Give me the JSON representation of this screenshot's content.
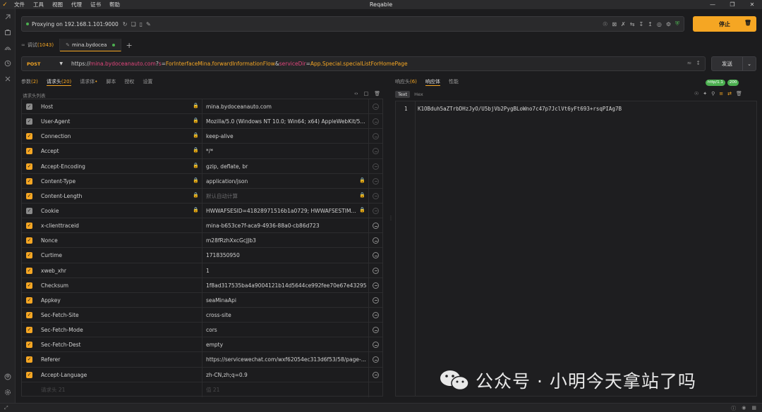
{
  "window": {
    "title": "Reqable",
    "menu": [
      "文件",
      "工具",
      "视图",
      "代理",
      "证书",
      "帮助"
    ]
  },
  "proxy": {
    "status_text": "Proxying on 192.168.1.101:9000",
    "stop_label": "停止"
  },
  "tabs": [
    {
      "label": "调试",
      "count": "(1043)"
    },
    {
      "label": "mina.bydocea"
    }
  ],
  "request": {
    "method": "POST",
    "url_scheme": "https://",
    "url_host": "mina.bydoceanauto.com",
    "url_q": "?",
    "param1_name": "s",
    "param1_eq": "=",
    "param1_value": "ForInterfaceMina.forwardInformationFlow",
    "param_amp": "&",
    "param2_name": "serviceDir",
    "param2_eq": "=",
    "param2_value": "App.Special.specialListForHomePage",
    "send_label": "发送"
  },
  "subtabs": [
    {
      "label": "参数",
      "count": "(2)"
    },
    {
      "label": "请求头",
      "count": "(20)"
    },
    {
      "label": "请求体",
      "count": "•"
    },
    {
      "label": "脚本",
      "count": ""
    },
    {
      "label": "授权",
      "count": ""
    },
    {
      "label": "设置",
      "count": ""
    }
  ],
  "headers_list_label": "请求头列表",
  "headers": [
    {
      "key": "Host",
      "value": "mina.bydoceanauto.com"
    },
    {
      "key": "User-Agent",
      "value": "Mozilla/5.0 (Windows NT 10.0; Win64; x64) AppleWebKit/5..."
    },
    {
      "key": "Connection",
      "value": "keep-alive"
    },
    {
      "key": "Accept",
      "value": "*/*"
    },
    {
      "key": "Accept-Encoding",
      "value": "gzip, deflate, br"
    },
    {
      "key": "Content-Type",
      "value": "application/json"
    },
    {
      "key": "Content-Length",
      "value": "默认自动计算"
    },
    {
      "key": "Cookie",
      "value": "HWWAFSESID=41828971516b1a0729; HWWAFSESTIM..."
    },
    {
      "key": "x-clienttraceid",
      "value": "mina-b653ce7f-aca9-4936-88a0-cb86d723"
    },
    {
      "key": "Nonce",
      "value": "m28fRzhXxcGcJJb3"
    },
    {
      "key": "Curtime",
      "value": "1718350950"
    },
    {
      "key": "xweb_xhr",
      "value": "1"
    },
    {
      "key": "Checksum",
      "value": "1f8ad317535ba4a9004121b14d5644ce992fee70e67e43295..."
    },
    {
      "key": "Appkey",
      "value": "seaMinaApi"
    },
    {
      "key": "Sec-Fetch-Site",
      "value": "cross-site"
    },
    {
      "key": "Sec-Fetch-Mode",
      "value": "cors"
    },
    {
      "key": "Sec-Fetch-Dest",
      "value": "empty"
    },
    {
      "key": "Referer",
      "value": "https://servicewechat.com/wxf62054ec313d6f53/58/page-..."
    },
    {
      "key": "Accept-Language",
      "value": "zh-CN,zh;q=0.9"
    },
    {
      "key": "请求头 21",
      "value": "值 21"
    }
  ],
  "response": {
    "tabs": [
      {
        "label": "响应头",
        "count": "(6)"
      },
      {
        "label": "响应体",
        "count": ""
      },
      {
        "label": "性能",
        "count": ""
      }
    ],
    "protocol_badge": "http/1.1",
    "status_badge": "200",
    "formats": [
      "Text",
      "Hex"
    ],
    "line_number": "1",
    "body": "K1OBduh5aZTrbDHzJyO/U5bjVb2PygBLoWno7c47p7JclVt6yFt693+rsqPIAg7B"
  },
  "watermark": "公众号 · 小明今天拿站了吗"
}
